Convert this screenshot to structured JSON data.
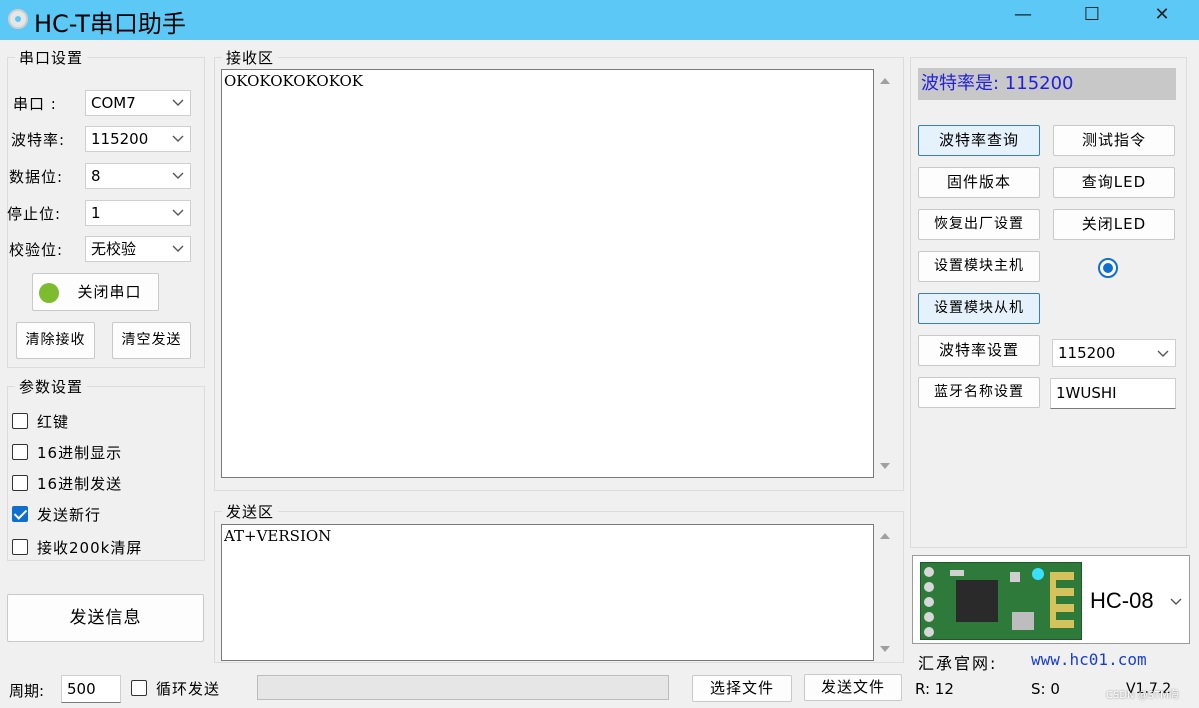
{
  "window": {
    "title": "HC-T串口助手",
    "minimize": "—",
    "maximize": "☐",
    "close": "✕"
  },
  "serial_settings": {
    "group_title": "串口设置",
    "port_label": "串口  :",
    "port_value": "COM7",
    "baud_label": "波特率:",
    "baud_value": "115200",
    "databits_label": "数据位:",
    "databits_value": "8",
    "stopbits_label": "停止位:",
    "stopbits_value": "1",
    "parity_label": "校验位:",
    "parity_value": "无校验",
    "toggle_port_button": "关闭串口",
    "port_status_color": "#7dbb2f",
    "clear_receive_button": "清除接收",
    "clear_send_button": "清空发送"
  },
  "param_settings": {
    "group_title": "参数设置",
    "options": [
      {
        "label": "红键",
        "checked": false
      },
      {
        "label": "16进制显示",
        "checked": false
      },
      {
        "label": "16进制发送",
        "checked": false
      },
      {
        "label": "发送新行",
        "checked": true
      },
      {
        "label": "接收200k清屏",
        "checked": false
      }
    ]
  },
  "send_message_button": "发送信息",
  "receive_area": {
    "title": "接收区",
    "content": "OKOKOKOKOKOK"
  },
  "send_area": {
    "title": "发送区",
    "content": "AT+VERSION"
  },
  "right_panel": {
    "baud_display": "波特率是: 115200",
    "buttons": {
      "query_baud": "波特率查询",
      "test_command": "测试指令",
      "firmware_version": "固件版本",
      "query_led": "查询LED",
      "factory_reset": "恢复出厂设置",
      "close_led": "关闭LED",
      "set_master": "设置模块主机",
      "set_slave": "设置模块从机",
      "set_baud": "波特率设置",
      "set_bt_name": "蓝牙名称设置"
    },
    "baud_select_value": "115200",
    "bt_name_value": "1WUSHI",
    "module_name": "HC-08",
    "website_label": "汇承官网:",
    "website_url": "www.hc01.com"
  },
  "bottom_bar": {
    "period_label": "周期:",
    "period_value": "500",
    "loop_send_label": "循环发送",
    "loop_send_checked": false,
    "choose_file_button": "选择文件",
    "send_file_button": "发送文件",
    "received_count": "R: 12",
    "sent_count": "S: 0",
    "version": "V1.7.2",
    "watermark": "CSDN @STM海"
  },
  "colors": {
    "titlebar": "#5cc8f5",
    "accent_blue": "#0f6fcf",
    "baud_text": "#2222dd",
    "url_text": "#1a3fd0"
  }
}
